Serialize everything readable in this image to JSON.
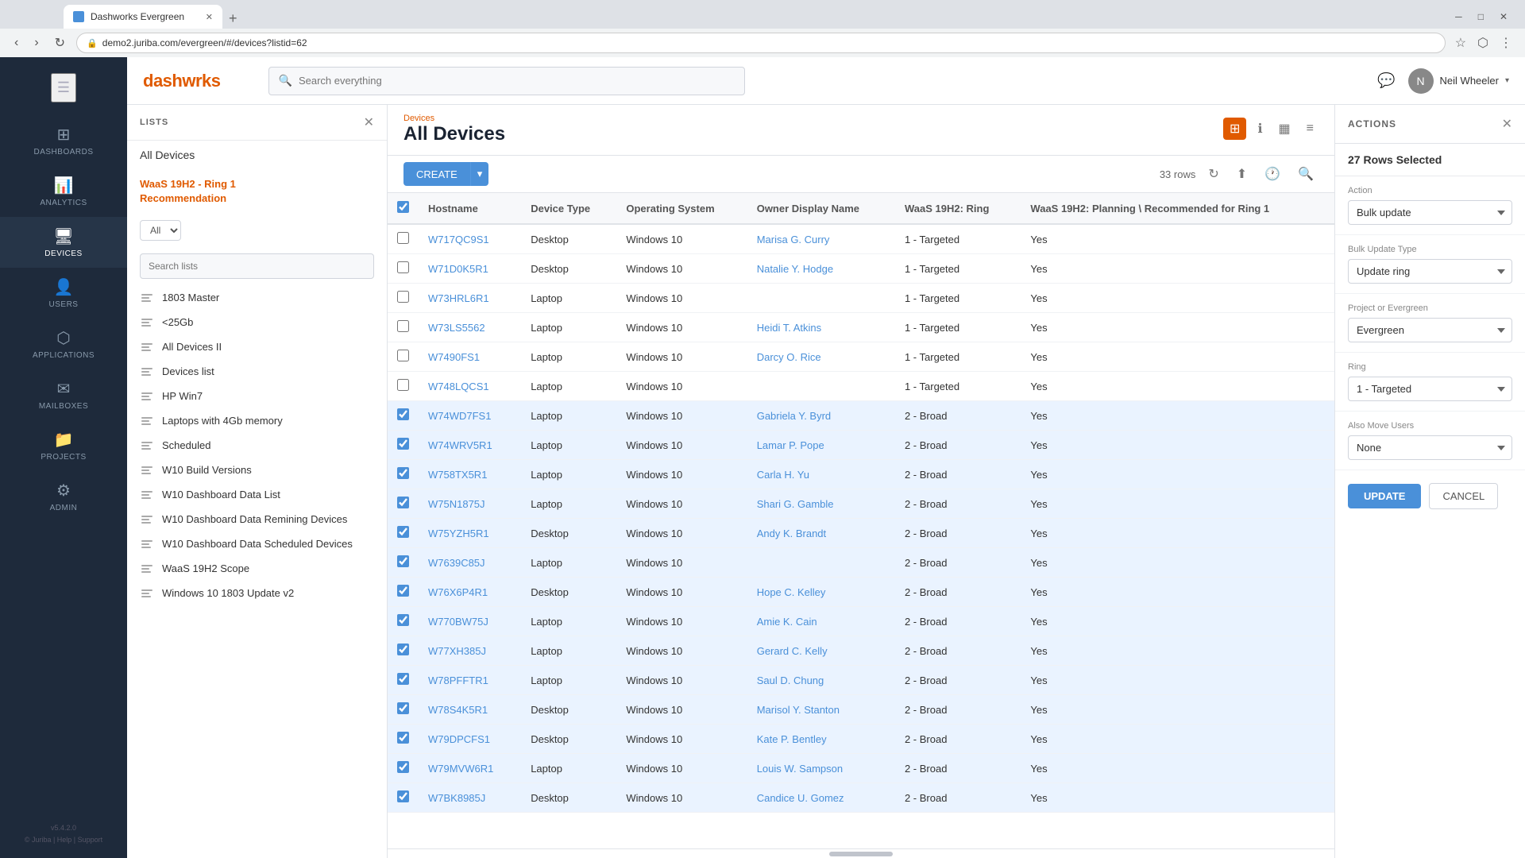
{
  "browser": {
    "tab_title": "Dashworks Evergreen",
    "url": "demo2.juriba.com/evergreen/#/devices?listid=62",
    "new_tab_label": "+"
  },
  "header": {
    "logo": "dashworks",
    "search_placeholder": "Search everything",
    "user_name": "Neil Wheeler",
    "message_icon": "💬"
  },
  "nav": {
    "items": [
      {
        "id": "dashboards",
        "label": "DASHBOARDS",
        "icon": "⊞"
      },
      {
        "id": "analytics",
        "label": "ANALYTICS",
        "icon": "📊"
      },
      {
        "id": "devices",
        "label": "DEVICES",
        "icon": "🖥"
      },
      {
        "id": "users",
        "label": "USERS",
        "icon": "👤"
      },
      {
        "id": "applications",
        "label": "APPLICATIONS",
        "icon": "⬡"
      },
      {
        "id": "mailboxes",
        "label": "MAILBOXES",
        "icon": "✉"
      },
      {
        "id": "projects",
        "label": "PROJECTS",
        "icon": "📁"
      },
      {
        "id": "admin",
        "label": "ADMIN",
        "icon": "⚙"
      }
    ],
    "active": "devices",
    "version": "v5.4.2.0",
    "footer_links": "© Juriba | Help | Support"
  },
  "lists_panel": {
    "title": "LISTS",
    "all_devices_label": "All Devices",
    "highlighted_list": "WaaS 19H2 - Ring 1\nRecommendation",
    "filter_options": [
      "All"
    ],
    "search_placeholder": "Search lists",
    "items": [
      {
        "label": "1803 Master"
      },
      {
        "label": "<25Gb"
      },
      {
        "label": "All Devices II"
      },
      {
        "label": "Devices list"
      },
      {
        "label": "HP Win7"
      },
      {
        "label": "Laptops with 4Gb memory"
      },
      {
        "label": "Scheduled"
      },
      {
        "label": "W10 Build Versions"
      },
      {
        "label": "W10 Dashboard Data List"
      },
      {
        "label": "W10 Dashboard Data Remining Devices"
      },
      {
        "label": "W10 Dashboard Data Scheduled Devices"
      },
      {
        "label": "WaaS 19H2 Scope"
      },
      {
        "label": "Windows 10 1803 Update v2"
      }
    ]
  },
  "page": {
    "breadcrumb": "Devices",
    "title": "All Devices"
  },
  "toolbar": {
    "create_label": "CREATE",
    "rows_count": "33 rows",
    "refresh_tooltip": "Refresh",
    "export_tooltip": "Export",
    "history_tooltip": "History",
    "search_tooltip": "Search"
  },
  "table": {
    "columns": [
      "Hostname",
      "Device Type",
      "Operating System",
      "Owner Display Name",
      "WaaS 19H2: Ring",
      "WaaS 19H2: Planning \\ Recommended for Ring 1"
    ],
    "rows": [
      {
        "hostname": "W717QC9S1",
        "device_type": "Desktop",
        "os": "Windows 10",
        "owner": "Marisa G. Curry",
        "ring": "1 - Targeted",
        "recommended": "Yes",
        "selected": false
      },
      {
        "hostname": "W71D0K5R1",
        "device_type": "Desktop",
        "os": "Windows 10",
        "owner": "Natalie Y. Hodge",
        "ring": "1 - Targeted",
        "recommended": "Yes",
        "selected": false
      },
      {
        "hostname": "W73HRL6R1",
        "device_type": "Laptop",
        "os": "Windows 10",
        "owner": "",
        "ring": "1 - Targeted",
        "recommended": "Yes",
        "selected": false
      },
      {
        "hostname": "W73LS5562",
        "device_type": "Laptop",
        "os": "Windows 10",
        "owner": "Heidi T. Atkins",
        "ring": "1 - Targeted",
        "recommended": "Yes",
        "selected": false
      },
      {
        "hostname": "W7490FS1",
        "device_type": "Laptop",
        "os": "Windows 10",
        "owner": "Darcy O. Rice",
        "ring": "1 - Targeted",
        "recommended": "Yes",
        "selected": false
      },
      {
        "hostname": "W748LQCS1",
        "device_type": "Laptop",
        "os": "Windows 10",
        "owner": "",
        "ring": "1 - Targeted",
        "recommended": "Yes",
        "selected": false
      },
      {
        "hostname": "W74WD7FS1",
        "device_type": "Laptop",
        "os": "Windows 10",
        "owner": "Gabriela Y. Byrd",
        "ring": "2 - Broad",
        "recommended": "Yes",
        "selected": true
      },
      {
        "hostname": "W74WRV5R1",
        "device_type": "Laptop",
        "os": "Windows 10",
        "owner": "Lamar P. Pope",
        "ring": "2 - Broad",
        "recommended": "Yes",
        "selected": true
      },
      {
        "hostname": "W758TX5R1",
        "device_type": "Laptop",
        "os": "Windows 10",
        "owner": "Carla H. Yu",
        "ring": "2 - Broad",
        "recommended": "Yes",
        "selected": true
      },
      {
        "hostname": "W75N1875J",
        "device_type": "Laptop",
        "os": "Windows 10",
        "owner": "Shari G. Gamble",
        "ring": "2 - Broad",
        "recommended": "Yes",
        "selected": true
      },
      {
        "hostname": "W75YZH5R1",
        "device_type": "Desktop",
        "os": "Windows 10",
        "owner": "Andy K. Brandt",
        "ring": "2 - Broad",
        "recommended": "Yes",
        "selected": true
      },
      {
        "hostname": "W7639C85J",
        "device_type": "Laptop",
        "os": "Windows 10",
        "owner": "",
        "ring": "2 - Broad",
        "recommended": "Yes",
        "selected": true
      },
      {
        "hostname": "W76X6P4R1",
        "device_type": "Desktop",
        "os": "Windows 10",
        "owner": "Hope C. Kelley",
        "ring": "2 - Broad",
        "recommended": "Yes",
        "selected": true
      },
      {
        "hostname": "W770BW75J",
        "device_type": "Laptop",
        "os": "Windows 10",
        "owner": "Amie K. Cain",
        "ring": "2 - Broad",
        "recommended": "Yes",
        "selected": true
      },
      {
        "hostname": "W77XH385J",
        "device_type": "Laptop",
        "os": "Windows 10",
        "owner": "Gerard C. Kelly",
        "ring": "2 - Broad",
        "recommended": "Yes",
        "selected": true
      },
      {
        "hostname": "W78PFFTR1",
        "device_type": "Laptop",
        "os": "Windows 10",
        "owner": "Saul D. Chung",
        "ring": "2 - Broad",
        "recommended": "Yes",
        "selected": true
      },
      {
        "hostname": "W78S4K5R1",
        "device_type": "Desktop",
        "os": "Windows 10",
        "owner": "Marisol Y. Stanton",
        "ring": "2 - Broad",
        "recommended": "Yes",
        "selected": true
      },
      {
        "hostname": "W79DPCFS1",
        "device_type": "Desktop",
        "os": "Windows 10",
        "owner": "Kate P. Bentley",
        "ring": "2 - Broad",
        "recommended": "Yes",
        "selected": true
      },
      {
        "hostname": "W79MVW6R1",
        "device_type": "Laptop",
        "os": "Windows 10",
        "owner": "Louis W. Sampson",
        "ring": "2 - Broad",
        "recommended": "Yes",
        "selected": true
      },
      {
        "hostname": "W7BK8985J",
        "device_type": "Desktop",
        "os": "Windows 10",
        "owner": "Candice U. Gomez",
        "ring": "2 - Broad",
        "recommended": "Yes",
        "selected": true
      }
    ]
  },
  "actions_panel": {
    "title": "ACTIONS",
    "rows_selected_label": "27 Rows Selected",
    "action_label": "Action",
    "action_value": "Bulk update",
    "bulk_update_type_label": "Bulk Update Type",
    "bulk_update_type_value": "Update ring",
    "project_label": "Project or Evergreen",
    "project_value": "Evergreen",
    "ring_label": "Ring",
    "ring_value": "1 - Targeted",
    "also_move_users_label": "Also Move Users",
    "also_move_users_value": "None",
    "update_btn": "UPDATE",
    "cancel_btn": "CANCEL"
  }
}
